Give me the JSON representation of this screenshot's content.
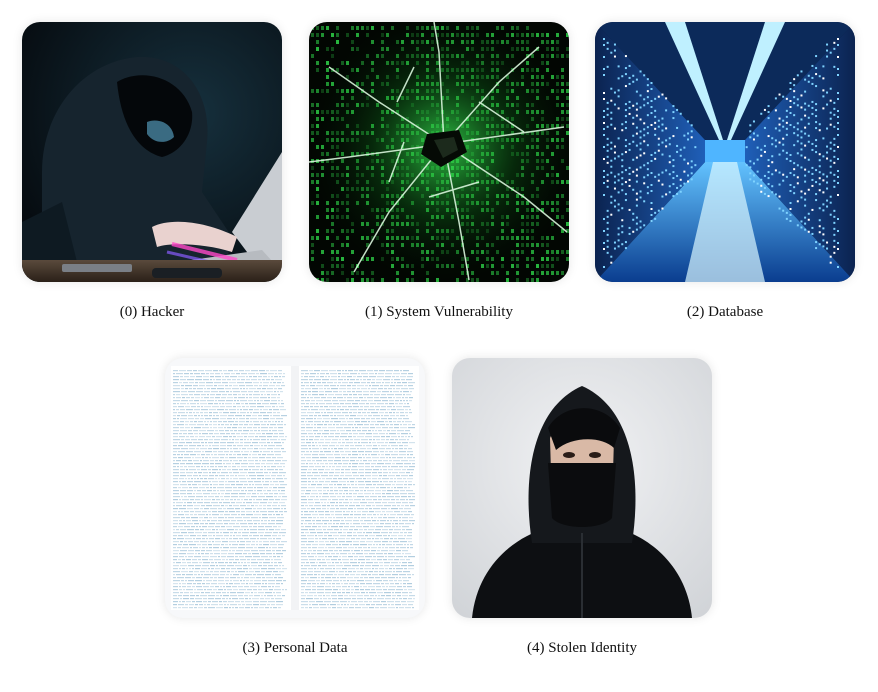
{
  "gallery": {
    "items": [
      {
        "caption": "(0) Hacker",
        "icon": "hacker-image"
      },
      {
        "caption": "(1) System Vulnerability",
        "icon": "shattered-code-image"
      },
      {
        "caption": "(2) Database",
        "icon": "server-room-image"
      },
      {
        "caption": "(3) Personal Data",
        "icon": "data-pages-image"
      },
      {
        "caption": "(4) Stolen Identity",
        "icon": "masked-person-image"
      }
    ]
  },
  "colors": {
    "hacker_bg": "#0b1a24",
    "code_green": "#2fd84a",
    "server_blue": "#1e7fe8",
    "data_text": "#a9c8dc",
    "wall_grey": "#e6e8ea"
  }
}
